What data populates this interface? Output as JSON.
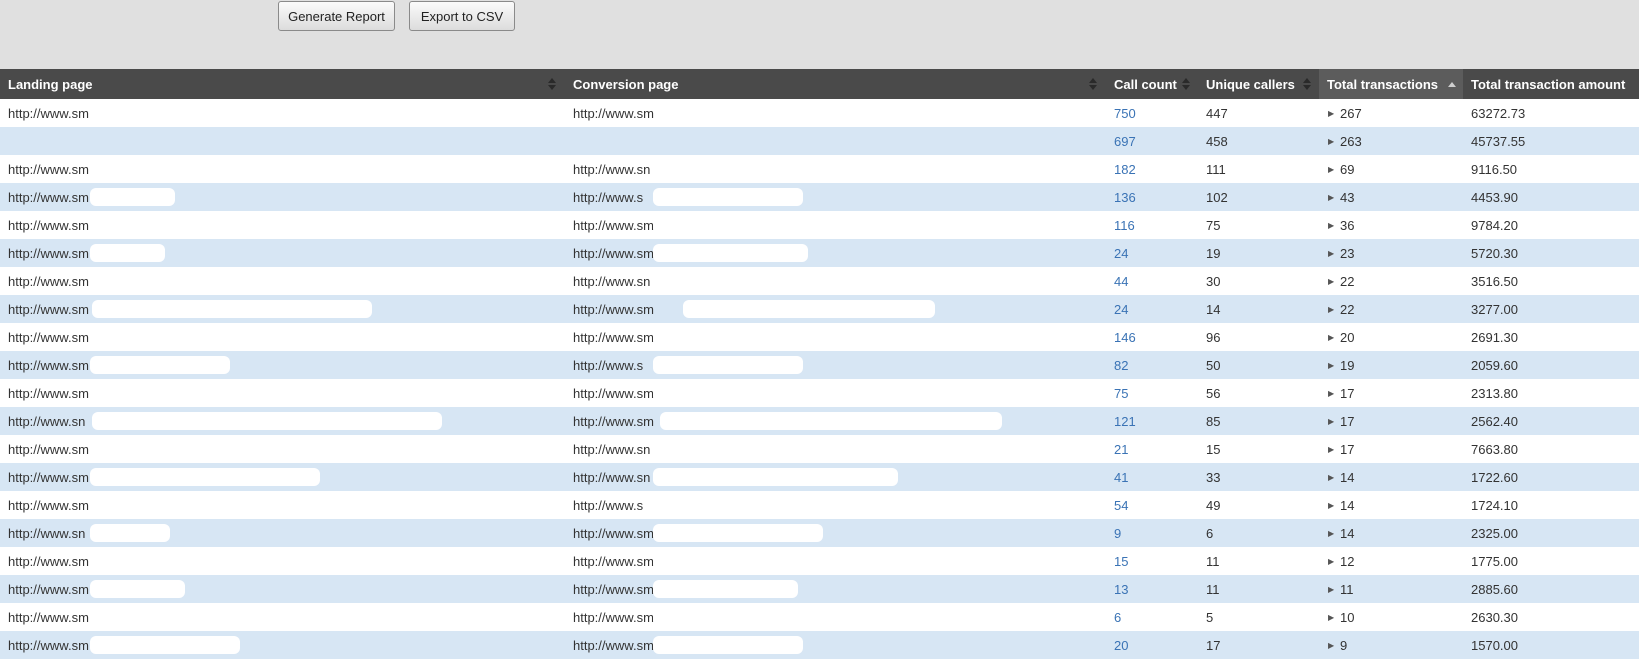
{
  "toolbar": {
    "generate_label": "Generate Report",
    "export_label": "Export to CSV"
  },
  "table": {
    "columns": {
      "landing": "Landing page",
      "conversion": "Conversion page",
      "calls": "Call count",
      "unique": "Unique callers",
      "transactions": "Total transactions",
      "amount": "Total transaction amount"
    },
    "sorted_column": "Total transactions",
    "sort_direction": "descending",
    "expand_icon": "triangle-right-icon",
    "colors": {
      "header_bg": "#4a4a4a",
      "row_alt": "#d7e6f4",
      "link": "#3a73b5",
      "toolbar_bg": "#e0e0e0"
    },
    "rows": [
      {
        "landing": "http://www.sm",
        "conversion": "http://www.sm",
        "calls": "750",
        "unique": "447",
        "transactions": "267",
        "amount": "63272.73"
      },
      {
        "landing": "",
        "conversion": "",
        "calls": "697",
        "unique": "458",
        "transactions": "263",
        "amount": "45737.55"
      },
      {
        "landing": "http://www.sm",
        "conversion": "http://www.sn",
        "calls": "182",
        "unique": "111",
        "transactions": "69",
        "amount": "9116.50"
      },
      {
        "landing": "http://www.sm",
        "conversion": "http://www.s",
        "calls": "136",
        "unique": "102",
        "transactions": "43",
        "amount": "4453.90"
      },
      {
        "landing": "http://www.sm",
        "conversion": "http://www.sm",
        "calls": "116",
        "unique": "75",
        "transactions": "36",
        "amount": "9784.20"
      },
      {
        "landing": "http://www.sm",
        "conversion": "http://www.sm",
        "calls": "24",
        "unique": "19",
        "transactions": "23",
        "amount": "5720.30"
      },
      {
        "landing": "http://www.sm",
        "conversion": "http://www.sn",
        "calls": "44",
        "unique": "30",
        "transactions": "22",
        "amount": "3516.50"
      },
      {
        "landing": "http://www.sm",
        "conversion": "http://www.sm",
        "calls": "24",
        "unique": "14",
        "transactions": "22",
        "amount": "3277.00"
      },
      {
        "landing": "http://www.sm",
        "conversion": "http://www.sm",
        "calls": "146",
        "unique": "96",
        "transactions": "20",
        "amount": "2691.30"
      },
      {
        "landing": "http://www.sm",
        "conversion": "http://www.s",
        "calls": "82",
        "unique": "50",
        "transactions": "19",
        "amount": "2059.60"
      },
      {
        "landing": "http://www.sm",
        "conversion": "http://www.sm",
        "calls": "75",
        "unique": "56",
        "transactions": "17",
        "amount": "2313.80"
      },
      {
        "landing": "http://www.sn",
        "conversion": "http://www.sm",
        "calls": "121",
        "unique": "85",
        "transactions": "17",
        "amount": "2562.40"
      },
      {
        "landing": "http://www.sm",
        "conversion": "http://www.sn",
        "calls": "21",
        "unique": "15",
        "transactions": "17",
        "amount": "7663.80"
      },
      {
        "landing": "http://www.sm",
        "conversion": "http://www.sn",
        "calls": "41",
        "unique": "33",
        "transactions": "14",
        "amount": "1722.60"
      },
      {
        "landing": "http://www.sm",
        "conversion": "http://www.s",
        "calls": "54",
        "unique": "49",
        "transactions": "14",
        "amount": "1724.10"
      },
      {
        "landing": "http://www.sn",
        "conversion": "http://www.sm",
        "calls": "9",
        "unique": "6",
        "transactions": "14",
        "amount": "2325.00"
      },
      {
        "landing": "http://www.sm",
        "conversion": "http://www.sm",
        "calls": "15",
        "unique": "11",
        "transactions": "12",
        "amount": "1775.00"
      },
      {
        "landing": "http://www.sm",
        "conversion": "http://www.sm",
        "calls": "13",
        "unique": "11",
        "transactions": "11",
        "amount": "2885.60"
      },
      {
        "landing": "http://www.sm",
        "conversion": "http://www.sm",
        "calls": "6",
        "unique": "5",
        "transactions": "10",
        "amount": "2630.30"
      },
      {
        "landing": "http://www.sm",
        "conversion": "http://www.sm",
        "calls": "20",
        "unique": "17",
        "transactions": "9",
        "amount": "1570.00"
      }
    ]
  }
}
